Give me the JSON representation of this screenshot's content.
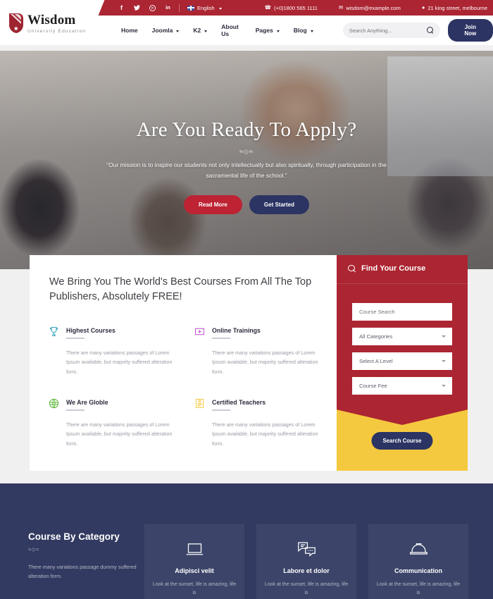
{
  "topbar": {
    "social": [
      {
        "name": "facebook-icon",
        "glyph": "f"
      },
      {
        "name": "twitter-icon",
        "glyph": "❧"
      },
      {
        "name": "pinterest-icon",
        "glyph": "ⓟ"
      },
      {
        "name": "linkedin-icon",
        "glyph": "in"
      }
    ],
    "language": "English",
    "phone": "(+0)1800 565 1111",
    "email": "wisdom@example.com",
    "address": "21 king street, melbourne",
    "phone_icon": "phone-icon",
    "email_icon": "envelope-icon",
    "address_icon": "map-pin-icon"
  },
  "logo": {
    "name": "Wisdom",
    "tagline": "University Education"
  },
  "nav": {
    "items": [
      {
        "label": "Home",
        "has_dropdown": false
      },
      {
        "label": "Joomla",
        "has_dropdown": true
      },
      {
        "label": "K2",
        "has_dropdown": true
      },
      {
        "label": "About Us",
        "has_dropdown": false
      },
      {
        "label": "Pages",
        "has_dropdown": true
      },
      {
        "label": "Blog",
        "has_dropdown": true
      }
    ],
    "search_placeholder": "Search Anything...",
    "search_value": "",
    "join_label": "Join Now"
  },
  "hero": {
    "title": "Are You Ready To Apply?",
    "ornament": "≈◇≈",
    "subtitle": "“Our mission is to inspire our students not only intellectually but also spiritually, through participation in the sacramental life of the school.”",
    "primary_btn": "Read More",
    "secondary_btn": "Get Started"
  },
  "courses": {
    "heading": "We Bring You The World's Best Courses From All The Top Publishers, Absolutely FREE!",
    "features": [
      {
        "icon": "trophy-icon",
        "color": "#3aa6b9",
        "title": "Highest Courses",
        "text": "There are many variations passages of Lorem Ipsum available, but majority suffered alteration form."
      },
      {
        "icon": "play-video-icon",
        "color": "#c14fd0",
        "title": "Online Trainings",
        "text": "There are many variations passages of Lorem Ipsum available, but majority suffered alteration form."
      },
      {
        "icon": "globe-icon",
        "color": "#5cb735",
        "title": "We Are Globle",
        "text": "There are many variations passages of Lorem Ipsum available, but majority suffered alteration form."
      },
      {
        "icon": "certificate-icon",
        "color": "#f5c93f",
        "title": "Certified Teachers",
        "text": "There are many variations passages of Lorem Ipsum available, but majority suffered alteration form."
      }
    ]
  },
  "find_course": {
    "title": "Find Your Course",
    "search_icon": "search-icon",
    "search_placeholder": "Course Search",
    "search_value": "",
    "selects": [
      {
        "name": "category-select",
        "value": "All Categories"
      },
      {
        "name": "level-select",
        "value": "Select A Level"
      },
      {
        "name": "fee-select",
        "value": "Course Fee"
      }
    ],
    "submit_label": "Search Course",
    "panel_color": "#ac2532",
    "accent_color": "#f5c93f"
  },
  "category": {
    "title": "Course By Category",
    "ornament": "≈◇≈",
    "text": "There many variations passage dummy suffered alteration form.",
    "cards": [
      {
        "icon": "laptop-icon",
        "title": "Adipisci velit",
        "text": "Look at the sunset, life is amazing, life is"
      },
      {
        "icon": "chat-bubbles-icon",
        "title": "Labore et dolor",
        "text": "Look at the sunset, life is amazing, life is"
      },
      {
        "icon": "hard-hat-icon",
        "title": "Communication",
        "text": "Look at the sunset, life is amazing, life is"
      }
    ]
  }
}
